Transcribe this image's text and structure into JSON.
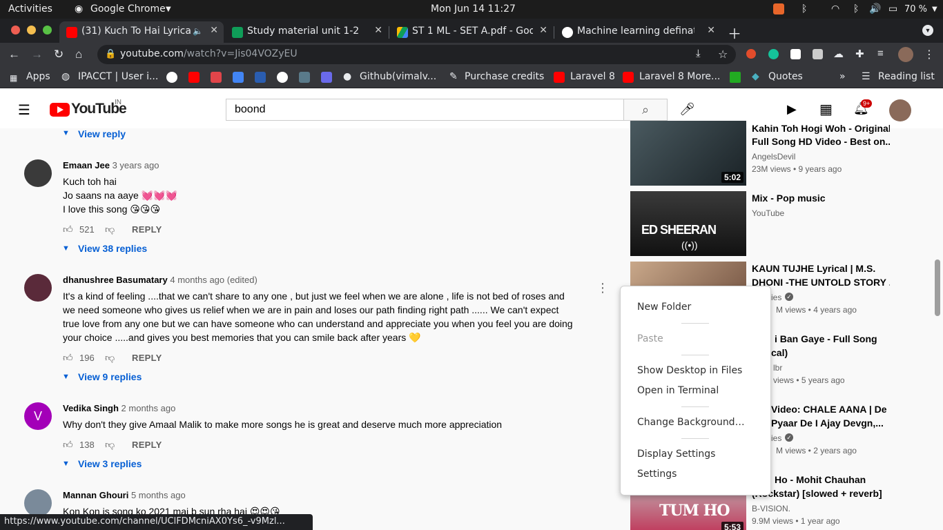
{
  "topbar": {
    "activities": "Activities",
    "app": "Google Chrome",
    "clock": "Mon Jun 14  11:27",
    "battery": "70 %"
  },
  "tabs": [
    {
      "title": "(31) Kuch To Hai Lyrica",
      "color": "#ff0000"
    },
    {
      "title": "Study material unit 1-2",
      "color": "#0f9d58"
    },
    {
      "title": "ST 1 ML - SET A.pdf - Goog",
      "color": "#4285f4"
    },
    {
      "title": "Machine learning definati",
      "color": "#ffffff"
    }
  ],
  "address": {
    "domain": "youtube.com",
    "path": "/watch?v=Jis04VOZyEU"
  },
  "bookmarks": [
    {
      "label": "Apps"
    },
    {
      "label": "IPACCT | User i..."
    },
    {
      "label": "Github(vimalv..."
    },
    {
      "label": "Purchase credits"
    },
    {
      "label": "Laravel 8"
    },
    {
      "label": "Laravel 8 More..."
    },
    {
      "label": "Quotes"
    },
    {
      "label": "Reading list"
    }
  ],
  "youtube": {
    "logo": "YouTube",
    "region": "IN",
    "search_value": "boond",
    "notif_count": "9+"
  },
  "top_view_reply": "View reply",
  "comments": [
    {
      "author": "Emaan Jee",
      "time": "3 years ago",
      "lines": [
        "Kuch toh hai",
        "Jo saans na aaye 💓💓💓",
        "I love this song 😘😘😘"
      ],
      "likes": "521",
      "reply": "REPLY",
      "view_replies": "View 38 replies",
      "avatar_color": "#3a3a3a"
    },
    {
      "author": "dhanushree Basumatary",
      "time": "4 months ago (edited)",
      "lines": [
        "It's a kind of feeling ....that we can't share to any one , but just we feel when we are alone , life is not bed of roses and",
        "we need someone who gives us relief when we are in pain and loses our path finding right path ...... We can't expect",
        "true love from any one but we can have someone who can understand and appreciate you when you feel you are doing",
        "your choice .....and gives you best memories that you can smile back after years 💛"
      ],
      "likes": "196",
      "reply": "REPLY",
      "view_replies": "View 9 replies",
      "avatar_color": "#5a2a3a"
    },
    {
      "author": "Vedika Singh",
      "time": "2 months ago",
      "lines": [
        "Why don't they give Amaal Malik to make more songs he is great and deserve much more appreciation"
      ],
      "likes": "138",
      "reply": "REPLY",
      "view_replies": "View 3 replies",
      "avatar_letter": "V",
      "avatar_color": "#a300b8"
    },
    {
      "author": "Mannan Ghouri",
      "time": "5 months ago",
      "lines": [
        "Kon Kon is song ko 2021 mai b sun rha hai 😍😍😘"
      ],
      "avatar_color": "#7a8a9a"
    }
  ],
  "sidebar": [
    {
      "title1": "Kahin Toh Hogi Woh - Original",
      "title2": "Full Song HD Video - Best on...",
      "channel": "AngelsDevil",
      "meta": "23M views • 9 years ago",
      "duration": "5:02",
      "thumb_color": "#2a3438"
    },
    {
      "title1": "Mix - Pop music",
      "title2": "",
      "channel": "YouTube",
      "meta": "",
      "duration": "",
      "thumb_color": "#1a1a1a",
      "overlay": "ED SHEERAN"
    },
    {
      "title1": "KAUN TUJHE Lyrical | M.S.",
      "title2": "DHONI -THE UNTOLD STORY ...",
      "channel": "ies",
      "meta": "M views • 4 years ago",
      "duration": "",
      "thumb_color": "#a08060"
    },
    {
      "title1": "i Ban Gaye - Full Song",
      "title2": "cal)",
      "channel": "lbr",
      "meta": "views • 5 years ago",
      "duration": "",
      "thumb_color": "#806050"
    },
    {
      "title1": "Video: CHALE AANA | De",
      "title2": "Pyaar De I Ajay Devgn,...",
      "channel": "ies",
      "meta": "M views • 2 years ago",
      "duration": "",
      "thumb_color": "#705060"
    },
    {
      "title1": "Ho - Mohit Chauhan",
      "title2": "(Rockstar) [slowed + reverb]",
      "channel": "B-VISION.",
      "meta": "9.9M views • 1 year ago",
      "duration": "5:53",
      "thumb_color": "#c04060",
      "overlay": "TUM HO"
    }
  ],
  "context_menu": {
    "new_folder": "New Folder",
    "paste": "Paste",
    "show_desktop": "Show Desktop in Files",
    "open_terminal": "Open in Terminal",
    "change_bg": "Change Background…",
    "display_settings": "Display Settings",
    "settings": "Settings"
  },
  "status_url": "https://www.youtube.com/channel/UClFDMcniAX0Ys6_-v9Mzl..."
}
